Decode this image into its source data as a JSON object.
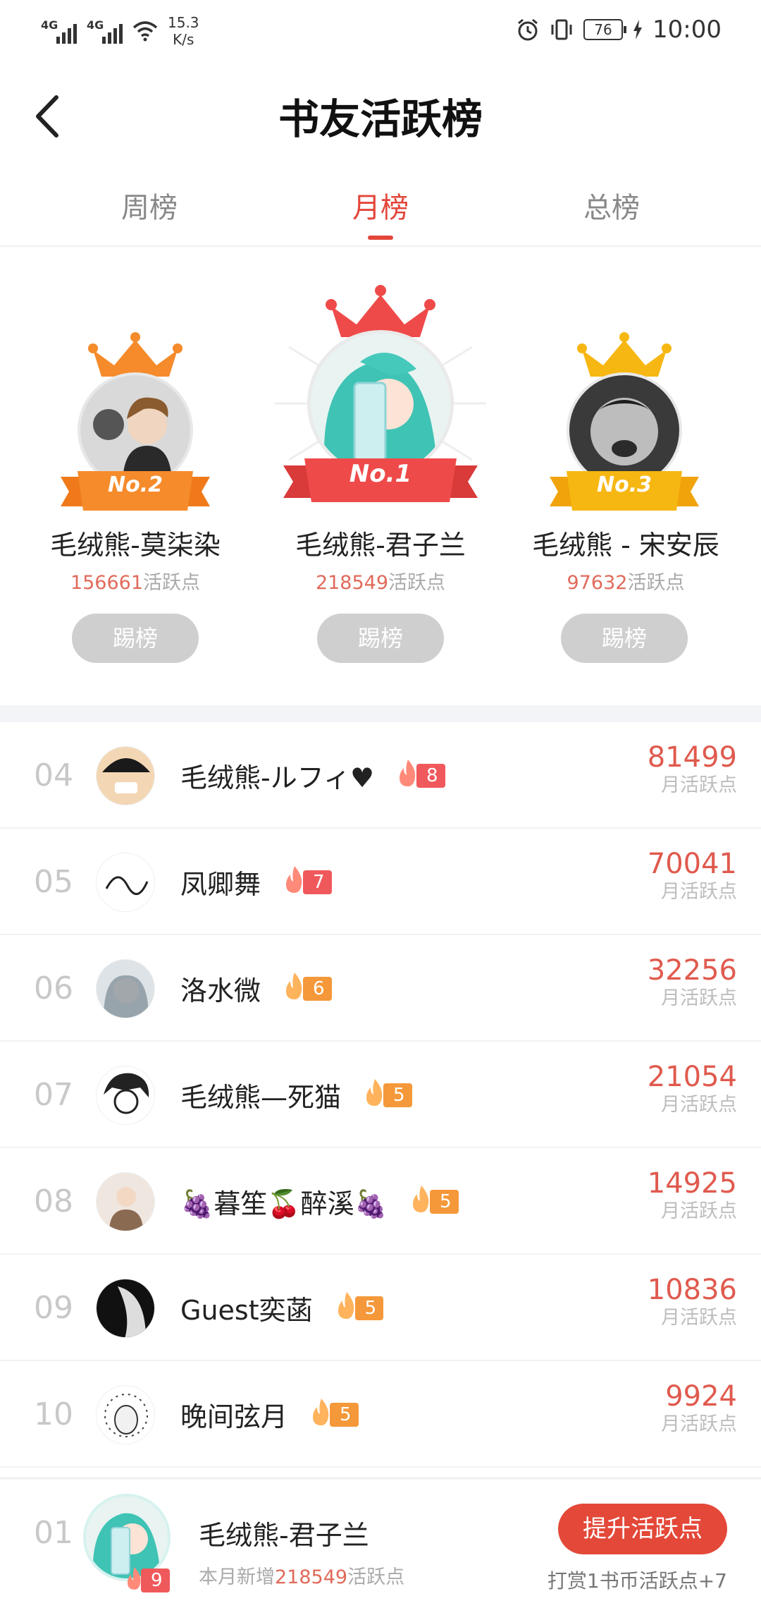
{
  "status_bar": {
    "network_1": "4G",
    "network_2": "4G",
    "speed_value": "15.3",
    "speed_unit": "K/s",
    "battery": "76",
    "time": "10:00"
  },
  "header": {
    "title": "书友活跃榜"
  },
  "tabs": [
    {
      "label": "周榜",
      "active": false
    },
    {
      "label": "月榜",
      "active": true
    },
    {
      "label": "总榜",
      "active": false
    }
  ],
  "podium": {
    "first": {
      "badge": "No.1",
      "name": "毛绒熊-君子兰",
      "points": "218549",
      "points_suffix": "活跃点",
      "kick_label": "踢榜"
    },
    "second": {
      "badge": "No.2",
      "name": "毛绒熊-莫柒染",
      "points": "156661",
      "points_suffix": "活跃点",
      "kick_label": "踢榜"
    },
    "third": {
      "badge": "No.3",
      "name": "毛绒熊 - 宋安辰",
      "points": "97632",
      "points_suffix": "活跃点",
      "kick_label": "踢榜"
    }
  },
  "ranking": {
    "score_label": "月活跃点",
    "rows": [
      {
        "rank": "04",
        "name": "毛绒熊-ルフィ♥",
        "level": "8",
        "level_color": "red",
        "score": "81499"
      },
      {
        "rank": "05",
        "name": "凤卿舞",
        "level": "7",
        "level_color": "red",
        "score": "70041"
      },
      {
        "rank": "06",
        "name": "洛水微",
        "level": "6",
        "level_color": "orange",
        "score": "32256"
      },
      {
        "rank": "07",
        "name": "毛绒熊—死猫",
        "level": "5",
        "level_color": "orange",
        "score": "21054"
      },
      {
        "rank": "08",
        "name": "🍇暮笙🍒醉溪🍇",
        "level": "5",
        "level_color": "orange",
        "score": "14925"
      },
      {
        "rank": "09",
        "name": "Guest奕菡",
        "level": "5",
        "level_color": "orange",
        "score": "10836"
      },
      {
        "rank": "10",
        "name": "晚间弦月",
        "level": "5",
        "level_color": "orange",
        "score": "9924"
      }
    ]
  },
  "bottom_bar": {
    "rank": "01",
    "name": "毛绒熊-君子兰",
    "level": "9",
    "sub_prefix": "本月新增",
    "sub_points": "218549",
    "sub_suffix": "活跃点",
    "boost_label": "提升活跃点",
    "reward_text": "打赏1书币活跃点+7"
  },
  "colors": {
    "accent": "#e3463a",
    "level_red": "#f0595b",
    "level_orange": "#f4983a",
    "gold": "#f7b712",
    "silver_orange": "#f58b2b"
  }
}
